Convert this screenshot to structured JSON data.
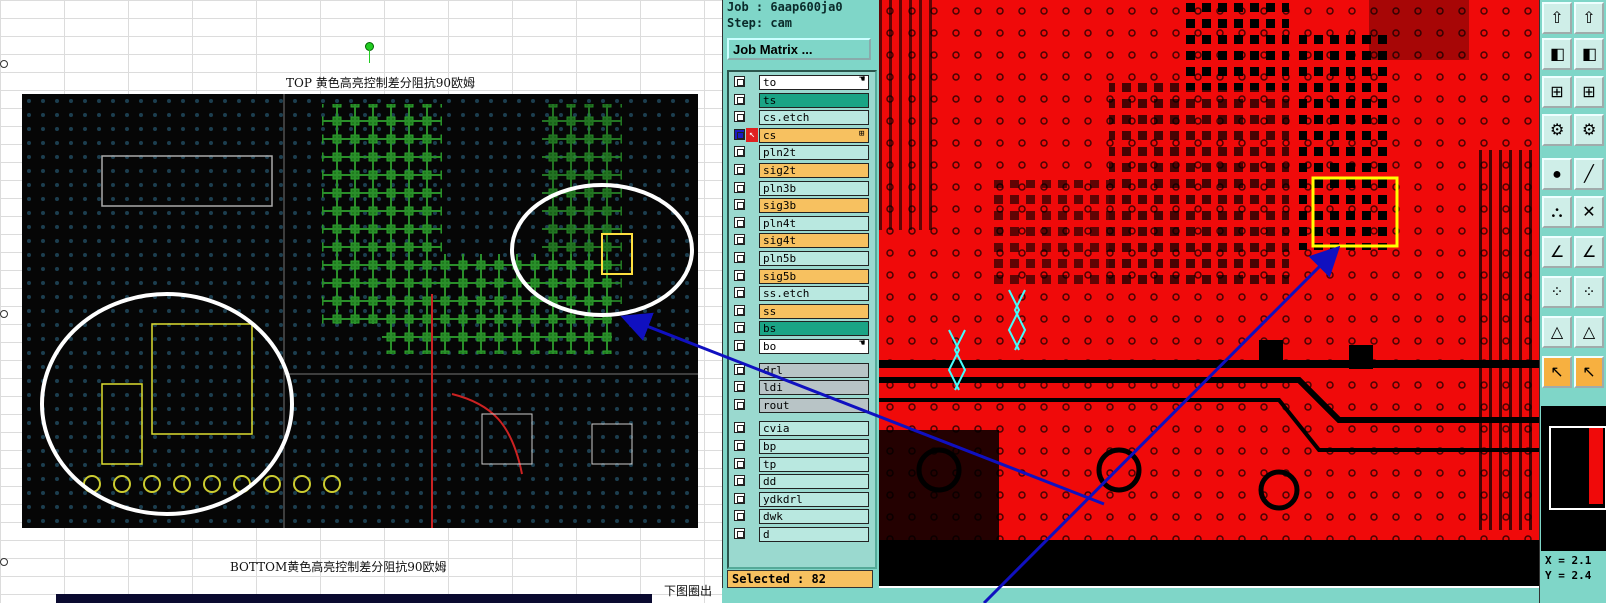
{
  "sheet": {
    "caption_top": "TOP  黄色高亮控制差分阻抗90欧姆",
    "caption_bottom": "BOTTOM黄色高亮控制差分阻抗90欧姆",
    "side_note": "下图圈出"
  },
  "cam_panel": {
    "job": "Job : 6aap600ja0",
    "step": "Step: cam",
    "job_matrix_button": "Job Matrix ...",
    "layers": [
      {
        "name": "to",
        "color": "white",
        "has_pointer": true
      },
      {
        "name": "ts",
        "color": "teal"
      },
      {
        "name": "cs.etch",
        "color": "light"
      },
      {
        "name": "cs",
        "color": "orange",
        "active": true
      },
      {
        "name": "pln2t",
        "color": "light"
      },
      {
        "name": "sig2t",
        "color": "orange"
      },
      {
        "name": "pln3b",
        "color": "light"
      },
      {
        "name": "sig3b",
        "color": "orange"
      },
      {
        "name": "pln4t",
        "color": "light"
      },
      {
        "name": "sig4t",
        "color": "orange"
      },
      {
        "name": "pln5b",
        "color": "light"
      },
      {
        "name": "sig5b",
        "color": "orange"
      },
      {
        "name": "ss.etch",
        "color": "light"
      },
      {
        "name": "ss",
        "color": "orange"
      },
      {
        "name": "bs",
        "color": "teal"
      },
      {
        "name": "bo",
        "color": "white",
        "has_pointer": true
      },
      {
        "name": "drl",
        "color": "grey"
      },
      {
        "name": "ldi",
        "color": "grey"
      },
      {
        "name": "rout",
        "color": "grey"
      },
      {
        "name": "cvia",
        "color": "light"
      },
      {
        "name": "bp",
        "color": "light"
      },
      {
        "name": "tp",
        "color": "light"
      },
      {
        "name": "dd",
        "color": "light"
      },
      {
        "name": "ydkdrl",
        "color": "light"
      },
      {
        "name": "dwk",
        "color": "light"
      },
      {
        "name": "d",
        "color": "light"
      }
    ],
    "selected": "Selected : 82"
  },
  "coords": {
    "x": "X = 2.1",
    "y": "Y = 2.4"
  },
  "colors": {
    "canvas_red": "#f00a0a",
    "panel_teal": "#7fd6c8",
    "highlight_yellow": "#ffff00",
    "annotation_blue": "#1010c0",
    "annotation_white": "#ffffff"
  }
}
